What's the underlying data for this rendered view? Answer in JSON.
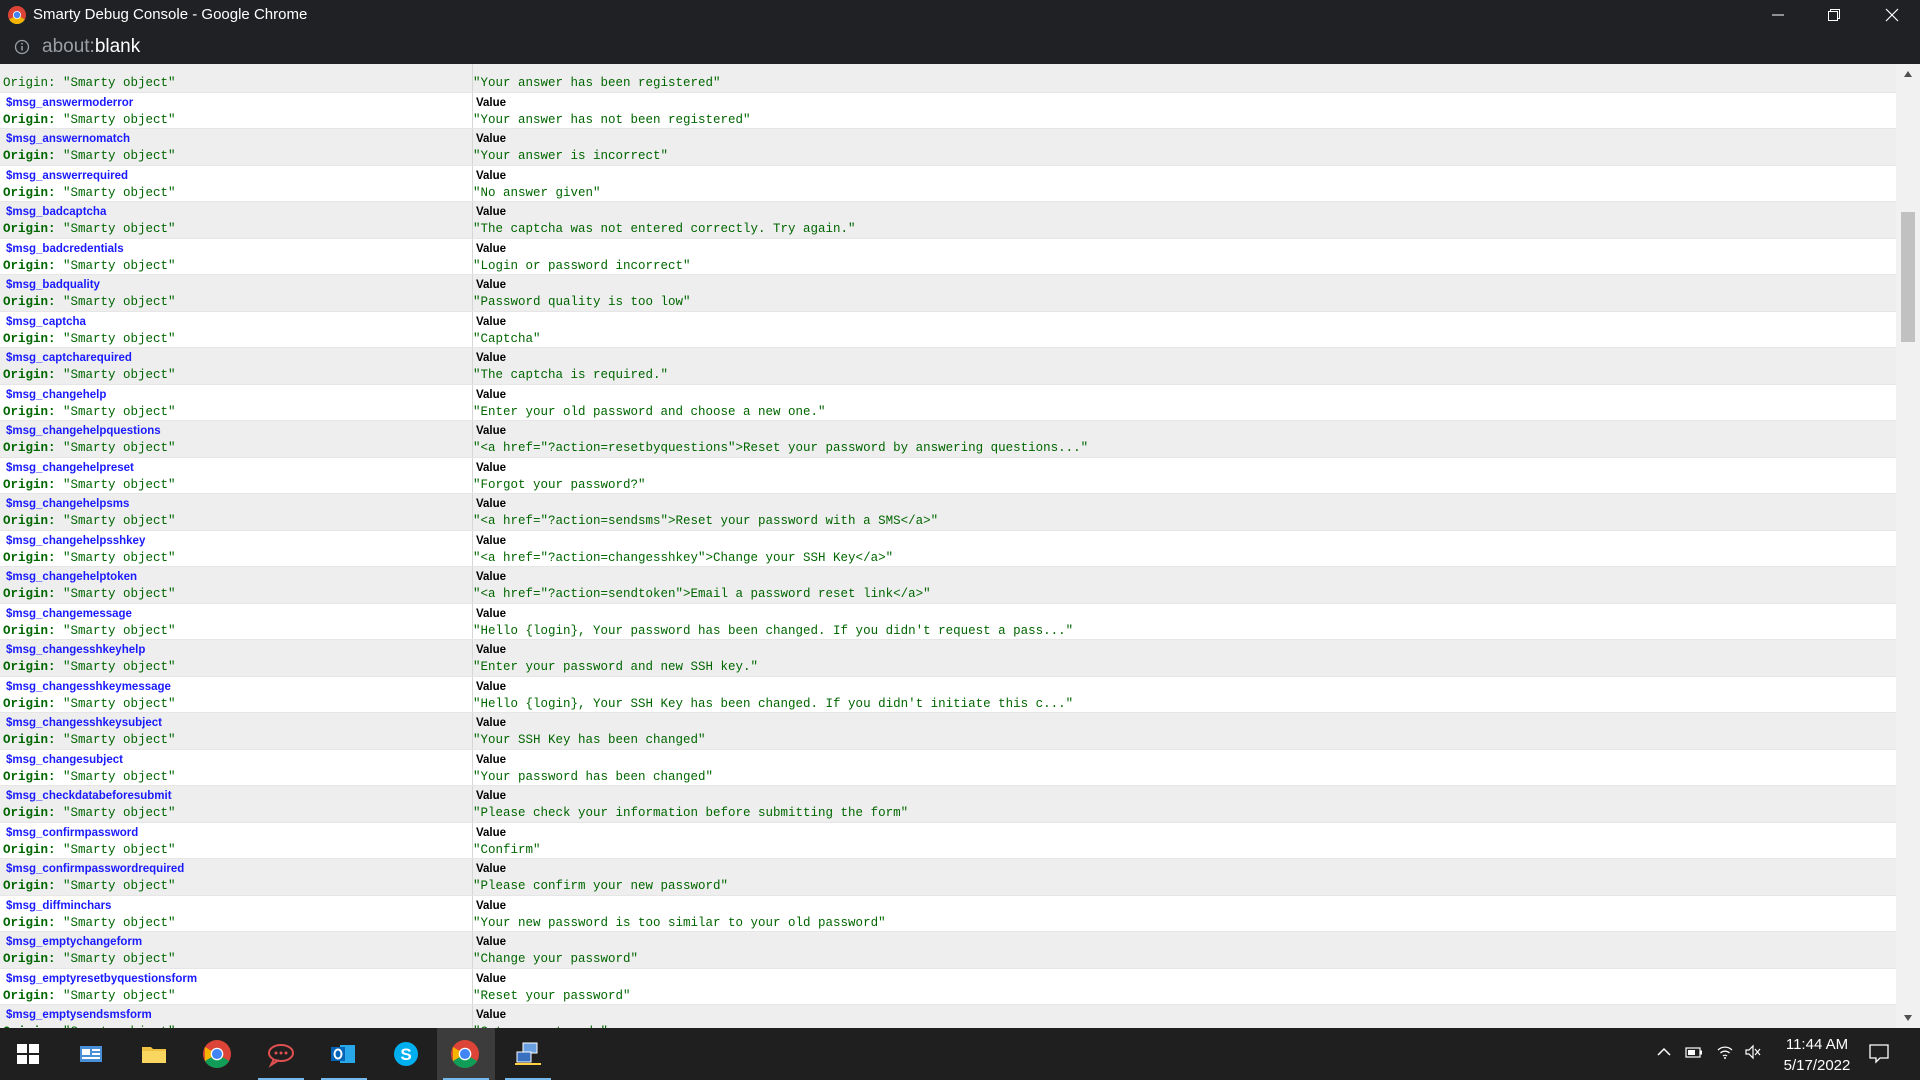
{
  "window": {
    "title": "Smarty Debug Console - Google Chrome",
    "url_scheme": "about:",
    "url_path": "blank"
  },
  "console": {
    "value_label": "Value",
    "origin_prefix": "Origin:",
    "origin_value": "\"Smarty object\"",
    "partial_top": {
      "origin": "Origin: \"Smarty object\"",
      "value": "\"Your answer has been registered\""
    },
    "rows": [
      {
        "name": "$msg_answermoderror",
        "value": "\"Your answer has not been registered\""
      },
      {
        "name": "$msg_answernomatch",
        "value": "\"Your answer is incorrect\""
      },
      {
        "name": "$msg_answerrequired",
        "value": "\"No answer given\""
      },
      {
        "name": "$msg_badcaptcha",
        "value": "\"The captcha was not entered correctly. Try again.\""
      },
      {
        "name": "$msg_badcredentials",
        "value": "\"Login or password incorrect\""
      },
      {
        "name": "$msg_badquality",
        "value": "\"Password quality is too low\""
      },
      {
        "name": "$msg_captcha",
        "value": "\"Captcha\""
      },
      {
        "name": "$msg_captcharequired",
        "value": "\"The captcha is required.\""
      },
      {
        "name": "$msg_changehelp",
        "value": "\"Enter your old password and choose a new one.\""
      },
      {
        "name": "$msg_changehelpquestions",
        "value": "\"<a href=\"?action=resetbyquestions\">Reset your password by answering questions...\""
      },
      {
        "name": "$msg_changehelpreset",
        "value": "\"Forgot your password?\""
      },
      {
        "name": "$msg_changehelpsms",
        "value": "\"<a href=\"?action=sendsms\">Reset your password with a SMS</a>\""
      },
      {
        "name": "$msg_changehelpsshkey",
        "value": "\"<a href=\"?action=changesshkey\">Change your SSH Key</a>\""
      },
      {
        "name": "$msg_changehelptoken",
        "value": "\"<a href=\"?action=sendtoken\">Email a password reset link</a>\""
      },
      {
        "name": "$msg_changemessage",
        "value": "\"Hello {login}, Your password has been changed. If you didn't request a pass...\""
      },
      {
        "name": "$msg_changesshkeyhelp",
        "value": "\"Enter your password and new SSH key.\""
      },
      {
        "name": "$msg_changesshkeymessage",
        "value": "\"Hello {login}, Your SSH Key has been changed. If you didn't initiate this c...\""
      },
      {
        "name": "$msg_changesshkeysubject",
        "value": "\"Your SSH Key has been changed\""
      },
      {
        "name": "$msg_changesubject",
        "value": "\"Your password has been changed\""
      },
      {
        "name": "$msg_checkdatabeforesubmit",
        "value": "\"Please check your information before submitting the form\""
      },
      {
        "name": "$msg_confirmpassword",
        "value": "\"Confirm\""
      },
      {
        "name": "$msg_confirmpasswordrequired",
        "value": "\"Please confirm your new password\""
      },
      {
        "name": "$msg_diffminchars",
        "value": "\"Your new password is too similar to your old password\""
      },
      {
        "name": "$msg_emptychangeform",
        "value": "\"Change your password\""
      },
      {
        "name": "$msg_emptyresetbyquestionsform",
        "value": "\"Reset your password\""
      },
      {
        "name": "$msg_emptysendsmsform",
        "value": "\"Get a reset code\""
      }
    ]
  },
  "taskbar": {
    "time": "11:44 AM",
    "date": "5/17/2022",
    "apps": [
      "start-icon",
      "news-icon",
      "file-explorer-icon",
      "chrome-icon",
      "chat-icon",
      "outlook-icon",
      "skype-icon",
      "chrome-active-icon",
      "remote-desktop-icon"
    ]
  }
}
